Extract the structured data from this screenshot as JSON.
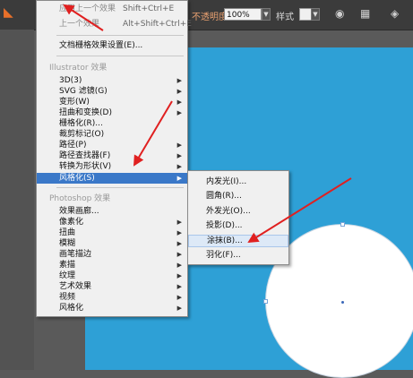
{
  "toolbar": {
    "opacity_label": "不透明度",
    "opacity_value": "100%",
    "style_label": "样式",
    "dropdown_icon": "chevron-down-icon",
    "style_swatch_color": "#f0f0f0"
  },
  "effect_menu": {
    "items_top": [
      {
        "label": "应用上一个效果",
        "shortcut": "Shift+Ctrl+E"
      },
      {
        "label": "上一个效果",
        "shortcut": "Alt+Shift+Ctrl+E"
      }
    ],
    "doc_raster_settings": "文档栅格效果设置(E)...",
    "illustrator_section": "Illustrator 效果",
    "illustrator_items": [
      "3D(3)",
      "SVG 滤镜(G)",
      "变形(W)",
      "扭曲和变换(D)",
      "栅格化(R)...",
      "裁剪标记(O)",
      "路径(P)",
      "路径查找器(F)",
      "转换为形状(V)",
      "风格化(S)"
    ],
    "photoshop_section": "Photoshop 效果",
    "photoshop_items": [
      "效果画廊...",
      "像素化",
      "扭曲",
      "模糊",
      "画笔描边",
      "素描",
      "纹理",
      "艺术效果",
      "视频",
      "风格化"
    ]
  },
  "stylize_submenu": {
    "items": [
      "内发光(I)...",
      "圆角(R)...",
      "外发光(O)...",
      "投影(D)...",
      "涂抹(B)...",
      "羽化(F)..."
    ]
  },
  "colors": {
    "canvas": "#2ea0d6",
    "highlight": "#3a78c8",
    "annotation_arrow": "#e02020"
  }
}
